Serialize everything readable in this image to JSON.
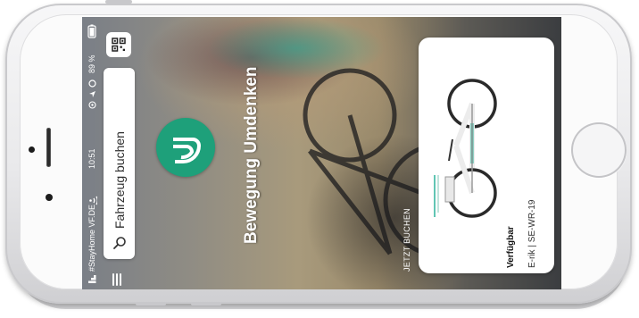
{
  "status_bar": {
    "carrier": "#StayHome VF.DE",
    "time": "10:51",
    "battery": "89 %"
  },
  "search": {
    "placeholder": "Fahrzeug buchen"
  },
  "brand": {
    "tagline": "Bewegung Umdenken",
    "logo_color": "#1ea07a"
  },
  "cta": {
    "label": "JETZT BUCHEN"
  },
  "vehicle_card": {
    "availability": "Verfügbar",
    "model": "E-rik | SE-WR-19"
  },
  "icons": [
    "signal-icon",
    "wifi-icon",
    "location-icon",
    "alarm-icon",
    "battery-icon",
    "qr-code-icon",
    "search-icon",
    "menu-icon",
    "brand-logo-icon",
    "e-bike-image"
  ]
}
